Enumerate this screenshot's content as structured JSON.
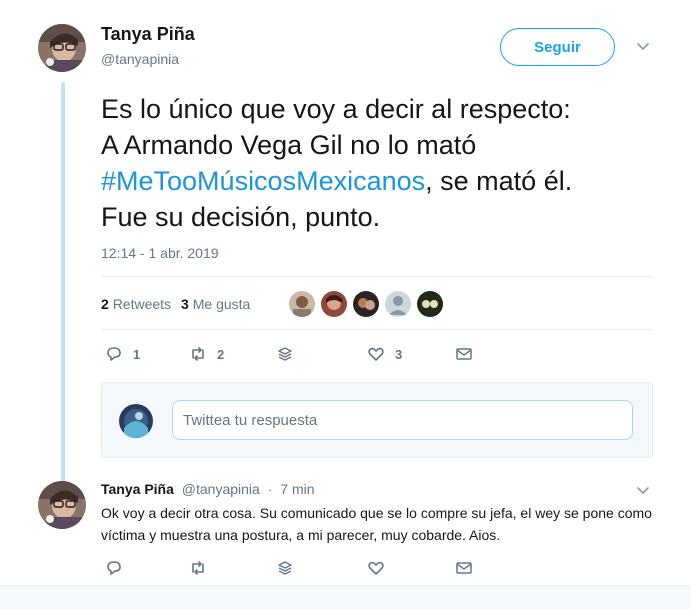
{
  "main_tweet": {
    "author_name": "Tanya Piña",
    "author_handle": "@tanyapinia",
    "follow_label": "Seguir",
    "text_line1": "Es lo único que voy a decir al respecto:",
    "text_line2": "A Armando Vega Gil no lo mató",
    "hashtag": "#MeTooMúsicosMexicanos",
    "text_after_hashtag": ", se mató él.",
    "text_line4": "Fue su decisión, punto.",
    "timestamp": "12:14 - 1 abr. 2019",
    "retweets_count": "2",
    "retweets_label": "Retweets",
    "likes_count": "3",
    "likes_label": "Me gusta",
    "actions": {
      "reply_count": "1",
      "retweet_count": "2",
      "like_count": "3"
    }
  },
  "reply_box": {
    "placeholder": "Twittea tu respuesta"
  },
  "reply_tweet": {
    "author_name": "Tanya Piña",
    "author_handle": "@tanyapinia",
    "separator": "·",
    "time": "7 min",
    "text": "Ok voy a decir otra cosa. Su comunicado que se lo compre su jefa, el wey se pone como víctima y muestra una postura, a mi parecer, muy cobarde. Aios."
  },
  "colors": {
    "accent": "#1da1f2",
    "hashtag": "#1b95e0",
    "muted": "#657786",
    "thread_line": "#c4e1f2"
  }
}
